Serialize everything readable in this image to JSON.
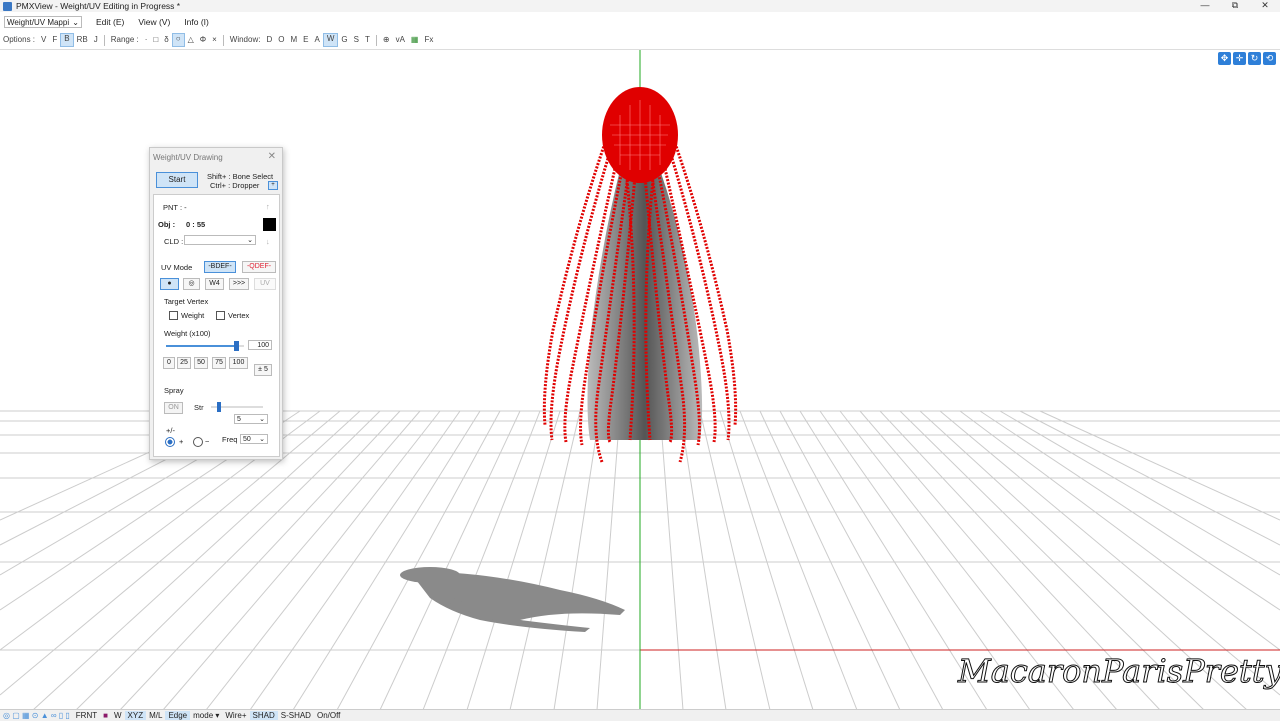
{
  "window": {
    "title": "PMXView - Weight/UV Editing in Progress *",
    "controls": [
      "—",
      "⧉",
      "✕"
    ]
  },
  "menubar": {
    "mode_select": "Weight/UV Mappi",
    "items": [
      "Edit (E)",
      "View (V)",
      "Info (I)"
    ]
  },
  "toolbar": {
    "options_label": "Options :",
    "options": [
      "V",
      "F",
      "B",
      "RB",
      "J"
    ],
    "options_active": "B",
    "range_label": "Range :",
    "range": [
      "·",
      "□",
      "δ",
      "○",
      "△",
      "Φ",
      "×"
    ],
    "range_active": "○",
    "window_label": "Window:",
    "window": [
      "D",
      "O",
      "M",
      "E",
      "A",
      "W",
      "G",
      "S",
      "T"
    ],
    "window_active": "W",
    "extra": [
      "⊕",
      "vA",
      "▦",
      "Fx"
    ]
  },
  "panel": {
    "title": "Weight/UV Drawing",
    "close": "✕",
    "start": "Start",
    "hint1": "Shift+ : Bone Select",
    "hint2": "Ctrl+ : Dropper",
    "pnt_label": "PNT : -",
    "obj_label": "Obj :",
    "obj_value": "0 : 55",
    "cld_label": "CLD :",
    "uvmode_label": "UV Mode",
    "bdef": "-BDEF-",
    "qdef": "-QDEF-",
    "mode_buttons": [
      "●",
      "◎",
      "W4",
      ">>>",
      "UV"
    ],
    "target_vertex_label": "Target Vertex",
    "cb_weight": "Weight",
    "cb_vertex": "Vertex",
    "weight_label": "Weight (x100)",
    "weight_value": "100",
    "weight_level": 1.0,
    "presets": [
      "0",
      "25",
      "50",
      "75",
      "100"
    ],
    "step": "± 5",
    "spray_label": "Spray",
    "on_label": "ON",
    "str_label": "Str",
    "str_value": "5",
    "plus_minus": "+/-",
    "plus": "+",
    "minus": "−",
    "freq_label": "Freq",
    "freq_value": "50"
  },
  "statusbar": {
    "items": [
      "FRNT",
      "W",
      "XYZ",
      "M/L",
      "Edge",
      "mode ▾",
      "Wire+",
      "SHAD",
      "S-SHAD",
      "On/Off"
    ],
    "active": [
      "XYZ",
      "SHAD"
    ]
  },
  "watermark": "MacaronParisPretty",
  "colors": {
    "model": "#e00000",
    "grid": "#c8c8c8",
    "accent": "#4a90d9",
    "y_axis": "#22aa22",
    "x_axis": "#cc2222"
  }
}
